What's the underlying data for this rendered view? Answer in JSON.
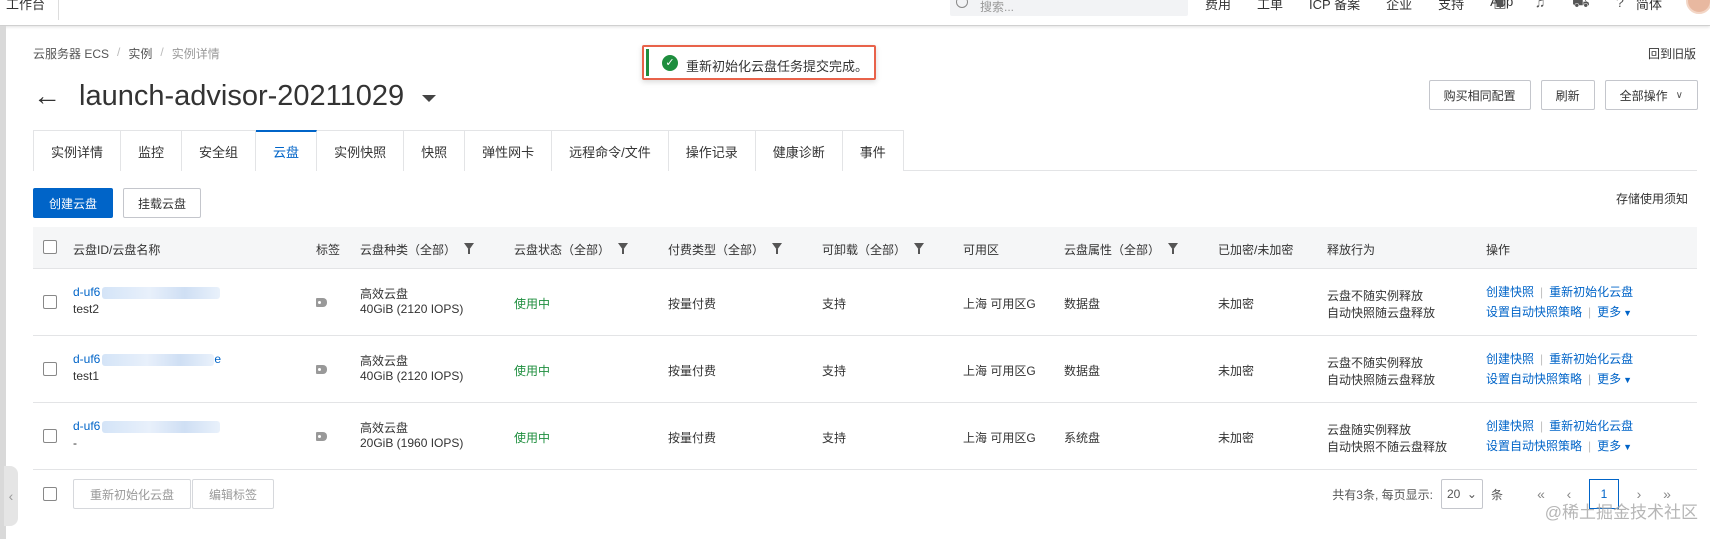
{
  "topbar": {
    "workspace": "工作台",
    "search_placeholder": "搜索...",
    "nav": [
      "费用",
      "工单",
      "ICP 备案",
      "企业",
      "支持",
      "App"
    ],
    "lang": "简体"
  },
  "breadcrumb": [
    "云服务器 ECS",
    "实例",
    "实例详情"
  ],
  "old_version": "回到旧版",
  "toast": {
    "message": "重新初始化云盘任务提交完成。"
  },
  "page": {
    "title": "launch-advisor-20211029"
  },
  "actions": {
    "buy_same": "购买相同配置",
    "refresh": "刷新",
    "all_ops": "全部操作"
  },
  "tabs": [
    {
      "label": "实例详情"
    },
    {
      "label": "监控"
    },
    {
      "label": "安全组"
    },
    {
      "label": "云盘"
    },
    {
      "label": "实例快照"
    },
    {
      "label": "快照"
    },
    {
      "label": "弹性网卡"
    },
    {
      "label": "远程命令/文件"
    },
    {
      "label": "操作记录"
    },
    {
      "label": "健康诊断"
    },
    {
      "label": "事件"
    }
  ],
  "toolbar": {
    "create_disk": "创建云盘",
    "attach_disk": "挂载云盘",
    "storage_note": "存储使用须知"
  },
  "table": {
    "headers": {
      "id": "云盘ID/云盘名称",
      "tag": "标签",
      "type": "云盘种类（全部）",
      "status": "云盘状态（全部）",
      "billing": "付费类型（全部）",
      "detachable": "可卸载（全部）",
      "zone": "可用区",
      "attr": "云盘属性（全部）",
      "encrypt": "已加密/未加密",
      "release": "释放行为",
      "ops": "操作"
    },
    "rows": [
      {
        "id_prefix": "d-uf6",
        "id_suffix": "",
        "name": "test2",
        "type": "高效云盘",
        "spec": "40GiB (2120 IOPS)",
        "status": "使用中",
        "billing": "按量付费",
        "detachable": "支持",
        "zone": "上海 可用区G",
        "attr": "数据盘",
        "encrypt": "未加密",
        "release1": "云盘不随实例释放",
        "release2": "自动快照随云盘释放"
      },
      {
        "id_prefix": "d-uf6",
        "id_suffix": "e",
        "name": "test1",
        "type": "高效云盘",
        "spec": "40GiB (2120 IOPS)",
        "status": "使用中",
        "billing": "按量付费",
        "detachable": "支持",
        "zone": "上海 可用区G",
        "attr": "数据盘",
        "encrypt": "未加密",
        "release1": "云盘不随实例释放",
        "release2": "自动快照随云盘释放"
      },
      {
        "id_prefix": "d-uf6",
        "id_suffix": "",
        "name": "-",
        "type": "高效云盘",
        "spec": "20GiB (1960 IOPS)",
        "status": "使用中",
        "billing": "按量付费",
        "detachable": "支持",
        "zone": "上海 可用区G",
        "attr": "系统盘",
        "encrypt": "未加密",
        "release1": "云盘随实例释放",
        "release2": "自动快照不随云盘释放"
      }
    ],
    "row_ops": {
      "create_snapshot": "创建快照",
      "reinit": "重新初始化云盘",
      "auto_snapshot": "设置自动快照策略",
      "more": "更多"
    }
  },
  "footer": {
    "reinit_btn": "重新初始化云盘",
    "edit_tags_btn": "编辑标签",
    "total_text": "共有3条, 每页显示:",
    "page_size": "20",
    "unit": "条",
    "current_page": "1"
  },
  "watermark": "@稀土掘金技术社区",
  "colors": {
    "primary": "#0064c8",
    "success": "#1e8e3e",
    "toast_border": "#e8624a"
  }
}
